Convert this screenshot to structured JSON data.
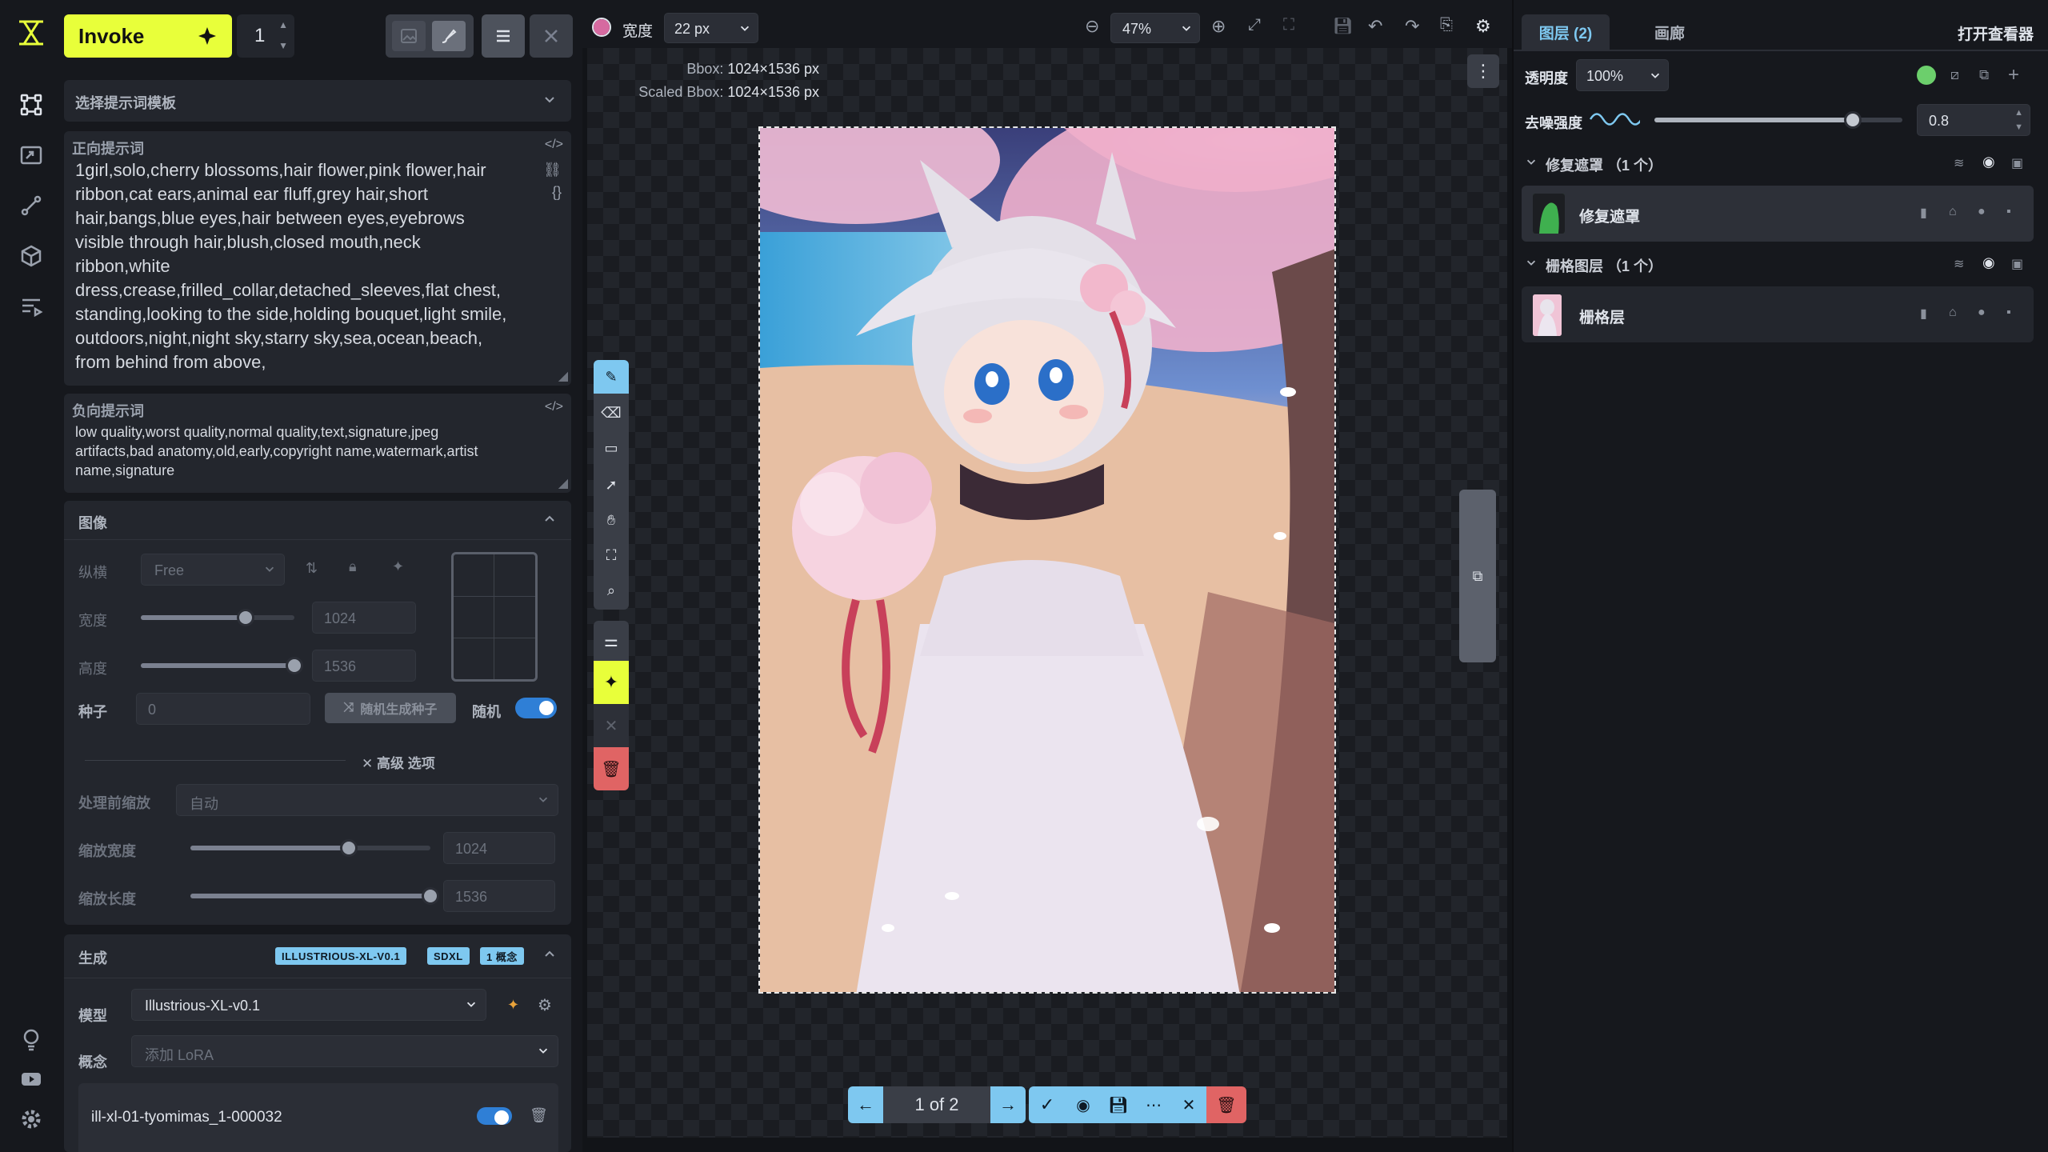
{
  "header": {
    "invoke_label": "Invoke",
    "iterations": "1"
  },
  "prompt_template": {
    "label": "选择提示词模板"
  },
  "positive_prompt": {
    "label": "正向提示词",
    "lines": [
      "1girl,solo,cherry blossoms,hair flower,pink flower,hair",
      "ribbon,cat ears,animal ear fluff,grey hair,short",
      "hair,bangs,blue eyes,hair between eyes,eyebrows",
      "visible through hair,blush,closed mouth,neck",
      "ribbon,white",
      "dress,crease,frilled_collar,detached_sleeves,flat chest,",
      "standing,looking to the side,holding bouquet,light smile,",
      "outdoors,night,night sky,starry sky,sea,ocean,beach,",
      "from behind from above,"
    ]
  },
  "negative_prompt": {
    "label": "负向提示词",
    "lines": [
      "low quality,worst quality,normal quality,text,signature,jpeg",
      "artifacts,bad anatomy,old,early,copyright name,watermark,artist",
      "name,signature"
    ]
  },
  "image_section": {
    "title": "图像",
    "aspect_label": "纵横",
    "aspect_value": "Free",
    "width_label": "宽度",
    "width_value": "1024",
    "width_fraction": 0.68,
    "height_label": "高度",
    "height_value": "1536",
    "height_fraction": 1.0,
    "seed_label": "种子",
    "seed_value": "0",
    "random_seed_button": "随机生成种子",
    "random_label": "随机",
    "random_on": true,
    "advanced_label": "高级 选项",
    "pre_scale_label": "处理前缩放",
    "pre_scale_value": "自动",
    "scaled_width_label": "缩放宽度",
    "scaled_width_value": "1024",
    "scaled_width_fraction": 0.66,
    "scaled_height_label": "缩放长度",
    "scaled_height_value": "1536",
    "scaled_height_fraction": 1.0
  },
  "generation": {
    "title": "生成",
    "tags": [
      "ILLUSTRIOUS-XL-V0.1",
      "SDXL",
      "1 概念"
    ],
    "model_label": "模型",
    "model_value": "Illustrious-XL-v0.1",
    "concept_label": "概念",
    "concept_placeholder": "添加 LoRA",
    "lora_name": "ill-xl-01-tyomimas_1-000032",
    "lora_enabled": true
  },
  "toolbar": {
    "width_label": "宽度",
    "brush_size": "22 px",
    "zoom": "47%",
    "brush_color": "#d66aa0"
  },
  "canvas": {
    "bbox_label": "Bbox:",
    "bbox_value": "1024×1536 px",
    "scaled_bbox_label": "Scaled Bbox:",
    "scaled_bbox_value": "1024×1536 px"
  },
  "staging": {
    "counter": "1 of 2"
  },
  "right_panel": {
    "tabs": [
      "图层 (2)",
      "画廊"
    ],
    "open_viewer": "打开查看器",
    "opacity_label": "透明度",
    "opacity_value": "100%",
    "denoise_label": "去噪强度",
    "denoise_value": "0.8",
    "denoise_fraction": 0.8,
    "groups": [
      {
        "title": "修复遮罩 （1 个）",
        "layer": "修复遮罩"
      },
      {
        "title": "栅格图层 （1 个）",
        "layer": "栅格层"
      }
    ],
    "accent": "#7ec8f0",
    "status_dot": "#6ccf6c"
  }
}
